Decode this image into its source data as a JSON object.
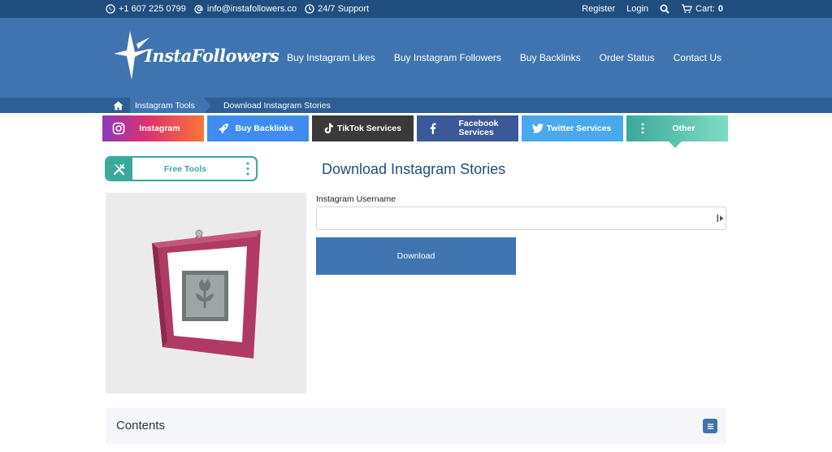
{
  "topbar": {
    "phone": "+1 607 225 0799",
    "email": "info@instafollowers.co",
    "support": "24/7 Support",
    "register": "Register",
    "login": "Login",
    "cart_label": "Cart:",
    "cart_count": "0"
  },
  "header": {
    "logo_text": "InstaFollowers",
    "nav": [
      {
        "label": "Buy Instagram Likes"
      },
      {
        "label": "Buy Instagram Followers"
      },
      {
        "label": "Buy Backlinks"
      },
      {
        "label": "Order Status"
      },
      {
        "label": "Contact Us"
      }
    ]
  },
  "breadcrumb": {
    "items": [
      {
        "label": "Instagram Tools"
      },
      {
        "label": "Download Instagram Stories"
      }
    ]
  },
  "tabs": [
    {
      "label": "Instagram"
    },
    {
      "label": "Buy Backlinks"
    },
    {
      "label": "TikTok Services"
    },
    {
      "label": "Facebook Services"
    },
    {
      "label": "Twitter Services"
    },
    {
      "label": "Other"
    }
  ],
  "sidebar": {
    "free_tools_label": "Free Tools"
  },
  "main": {
    "title": "Download Instagram Stories",
    "username_label": "Instagram Username",
    "username_value": "",
    "download_label": "Download"
  },
  "contents": {
    "label": "Contents"
  },
  "colors": {
    "topbar": "#1f4e7e",
    "header": "#3f74b0",
    "breadcrumb": "#2d5f94",
    "accent_teal": "#3aa99a",
    "frame": "#b03a64"
  }
}
